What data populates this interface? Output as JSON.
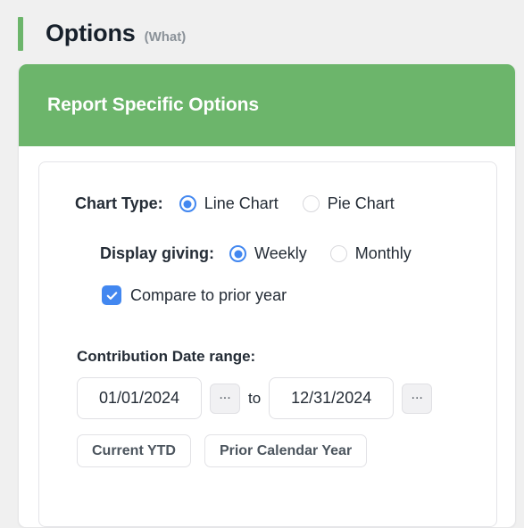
{
  "header": {
    "title": "Options",
    "subtitle": "(What)",
    "accent_color": "#6cb56b"
  },
  "card": {
    "header_title": "Report Specific Options",
    "header_color": "#6cb56b"
  },
  "form": {
    "chart_type": {
      "label": "Chart Type:",
      "options": [
        {
          "label": "Line Chart",
          "selected": true
        },
        {
          "label": "Pie Chart",
          "selected": false
        }
      ]
    },
    "display_giving": {
      "label": "Display giving:",
      "options": [
        {
          "label": "Weekly",
          "selected": true
        },
        {
          "label": "Monthly",
          "selected": false
        }
      ]
    },
    "compare_prior_year": {
      "label": "Compare to prior year",
      "checked": true
    },
    "date_range": {
      "label": "Contribution Date range:",
      "start_value": "01/01/2024",
      "end_value": "12/31/2024",
      "separator": "to",
      "picker_label": "...",
      "presets": [
        {
          "label": "Current YTD"
        },
        {
          "label": "Prior Calendar Year"
        }
      ]
    }
  },
  "colors": {
    "accent_green": "#6cb56b",
    "control_blue": "#4287f0",
    "text_dark": "#242c36",
    "text_muted": "#8b9299"
  }
}
